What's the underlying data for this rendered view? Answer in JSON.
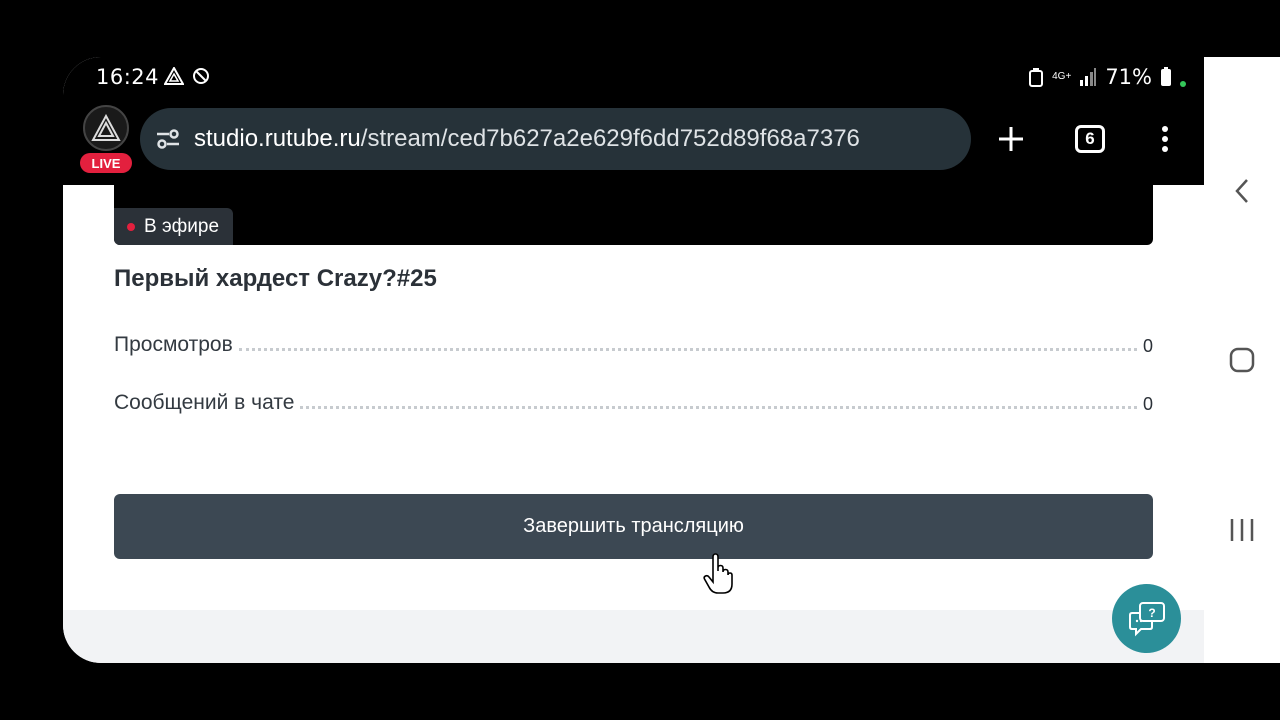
{
  "status_bar": {
    "time": "16:24",
    "network": "4G+",
    "battery_percent": "71%"
  },
  "browser": {
    "url_domain": "studio.rutube.ru",
    "url_path": "/stream/ced7b627a2e629f6dd752d89f68a7376",
    "tabs_count": "6",
    "live_badge": "LIVE"
  },
  "stream": {
    "on_air_label": "В эфире",
    "title": "Первый хардест Crazy?#25",
    "stats": [
      {
        "label": "Просмотров",
        "value": "0"
      },
      {
        "label": "Сообщений в чате",
        "value": "0"
      }
    ],
    "end_button_label": "Завершить трансляцию"
  },
  "colors": {
    "accent_red": "#e3203e",
    "button_dark": "#3c4853",
    "help_teal": "#2b8f99"
  }
}
